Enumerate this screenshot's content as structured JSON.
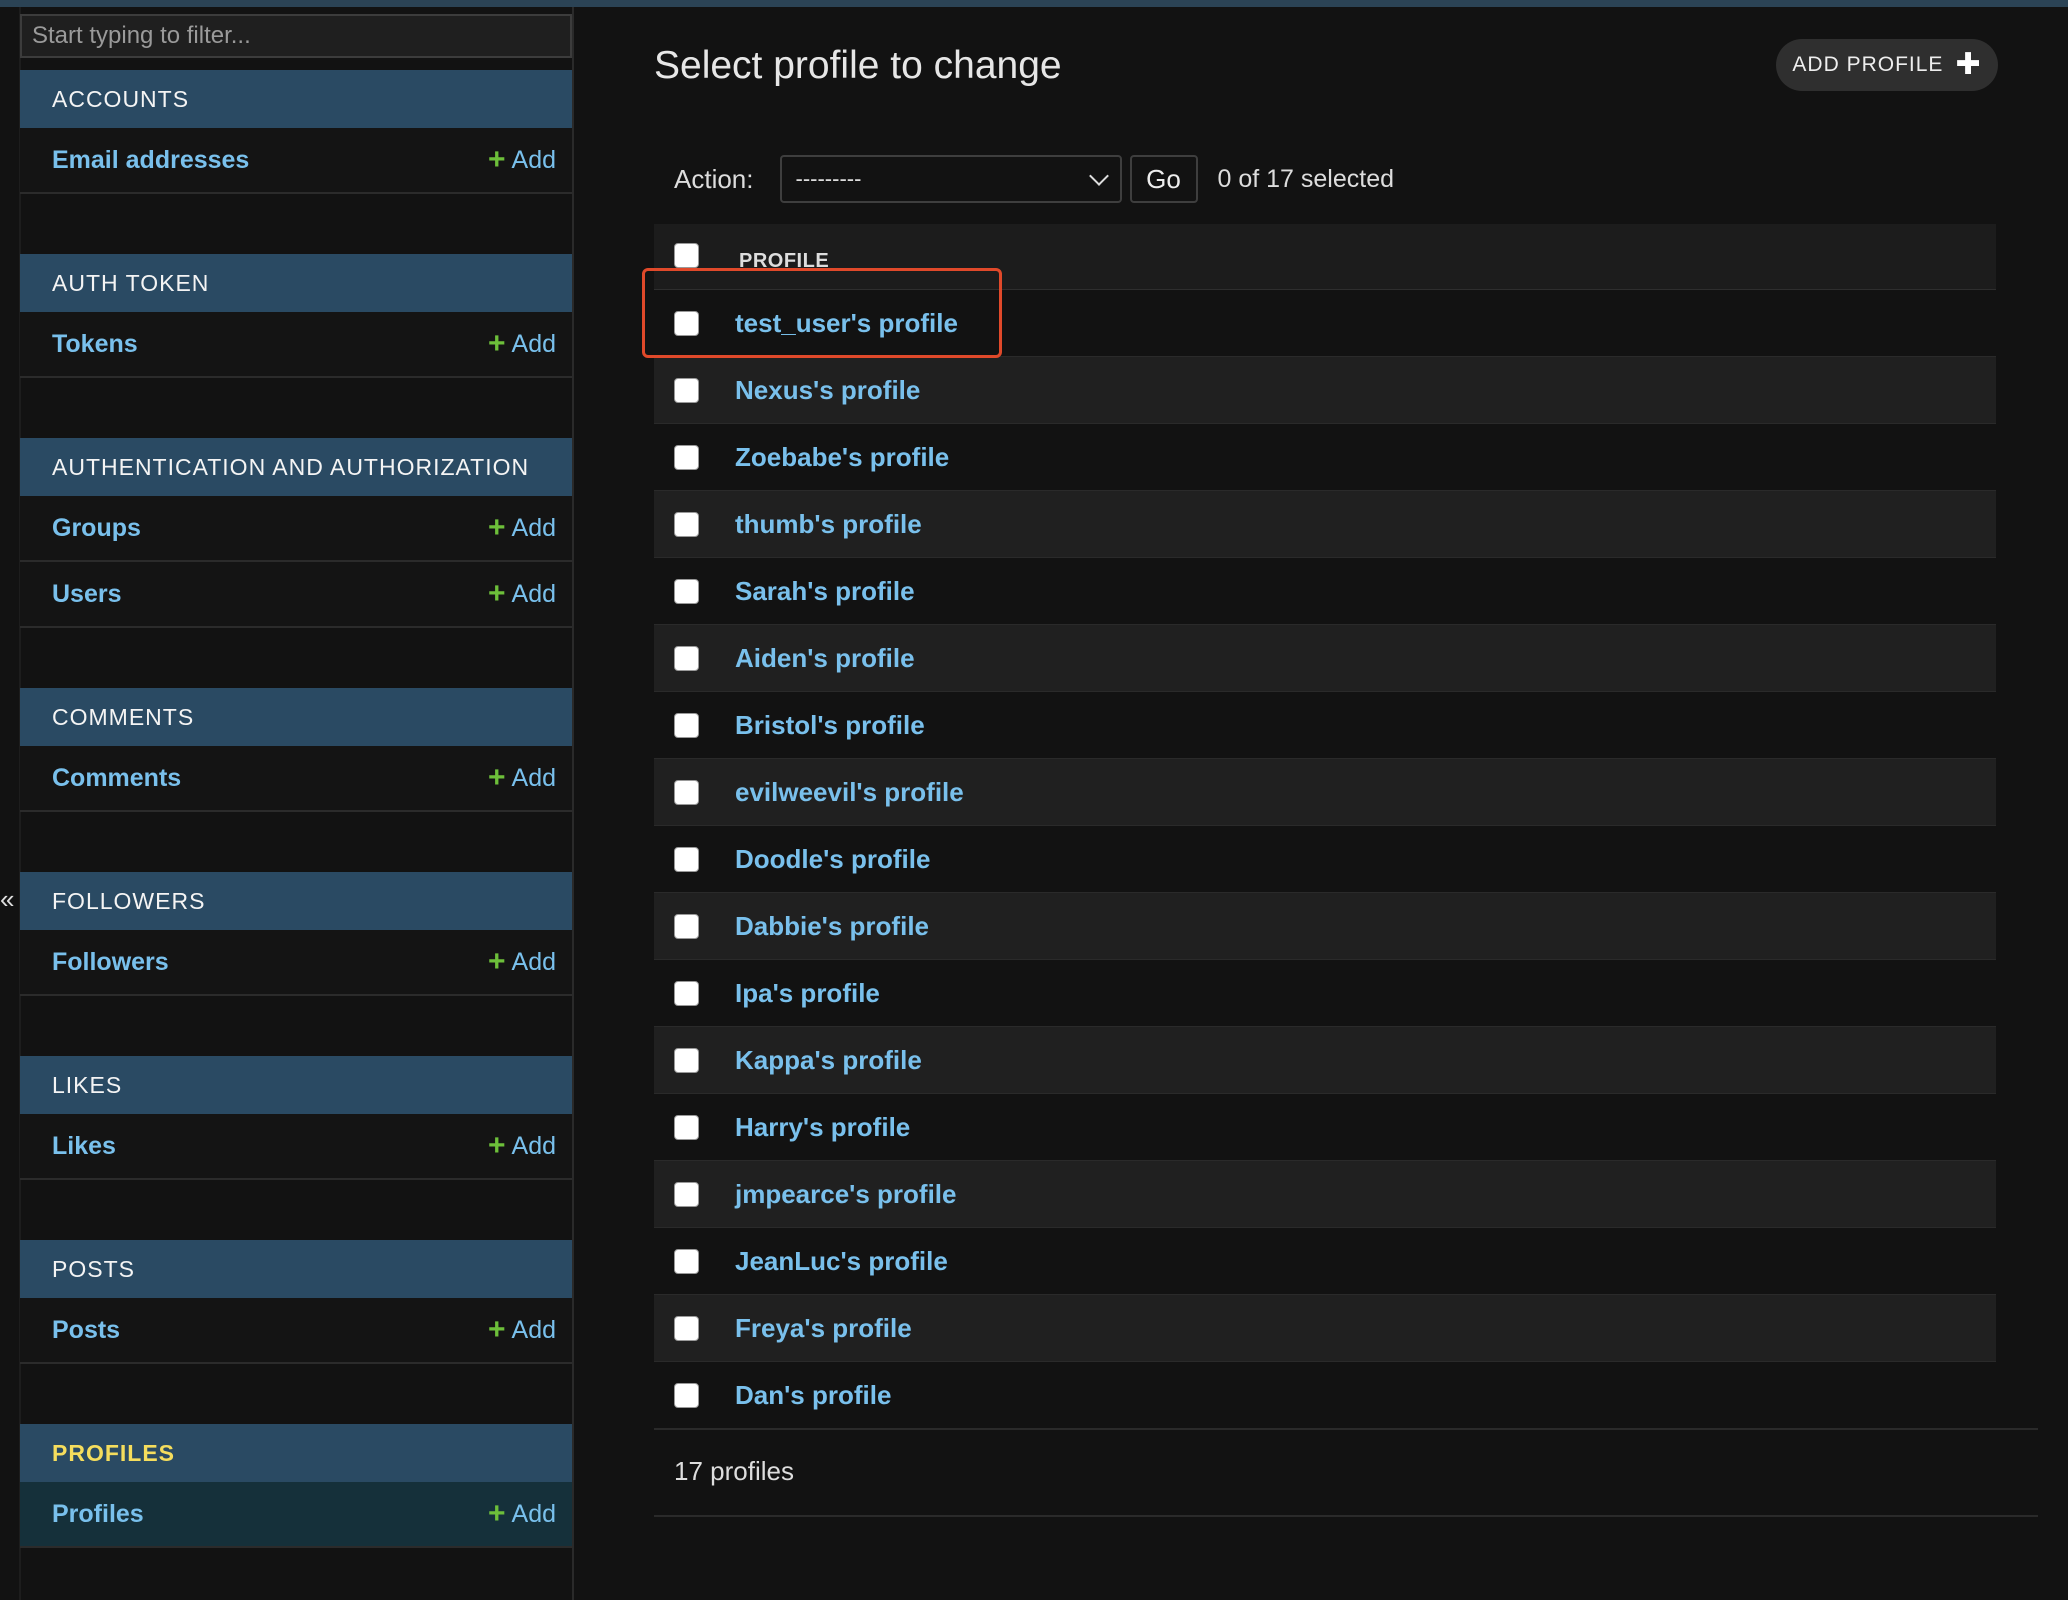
{
  "sidebar": {
    "filter_placeholder": "Start typing to filter...",
    "collapse_glyph": "«",
    "add_label": "Add",
    "modules": [
      {
        "header": "ACCOUNTS",
        "models": [
          {
            "label": "Email addresses"
          }
        ]
      },
      {
        "header": "AUTH TOKEN",
        "models": [
          {
            "label": "Tokens"
          }
        ]
      },
      {
        "header": "AUTHENTICATION AND AUTHORIZATION",
        "models": [
          {
            "label": "Groups"
          },
          {
            "label": "Users"
          }
        ]
      },
      {
        "header": "COMMENTS",
        "models": [
          {
            "label": "Comments"
          }
        ]
      },
      {
        "header": "FOLLOWERS",
        "models": [
          {
            "label": "Followers"
          }
        ]
      },
      {
        "header": "LIKES",
        "models": [
          {
            "label": "Likes"
          }
        ]
      },
      {
        "header": "POSTS",
        "models": [
          {
            "label": "Posts"
          }
        ]
      },
      {
        "header": "PROFILES",
        "models": [
          {
            "label": "Profiles"
          }
        ]
      }
    ]
  },
  "main": {
    "title": "Select profile to change",
    "add_button_label": "ADD PROFILE",
    "action_label": "Action:",
    "action_selected": "---------",
    "go_label": "Go",
    "selected_count": "0 of 17 selected",
    "column_header": "PROFILE",
    "rows": [
      "test_user's profile",
      "Nexus's profile",
      "Zoebabe's profile",
      "thumb's profile",
      "Sarah's profile",
      "Aiden's profile",
      "Bristol's profile",
      "evilweevil's profile",
      "Doodle's profile",
      "Dabbie's profile",
      "Ipa's profile",
      "Kappa's profile",
      "Harry's profile",
      "jmpearce's profile",
      "JeanLuc's profile",
      "Freya's profile",
      "Dan's profile"
    ],
    "paginator": "17 profiles"
  },
  "colors": {
    "module_header_bg": "#2a4a63",
    "link": "#79c0ec",
    "add_plus": "#6dbf3a",
    "current_header_text": "#f5dd5d",
    "highlight": "#e0492a"
  }
}
